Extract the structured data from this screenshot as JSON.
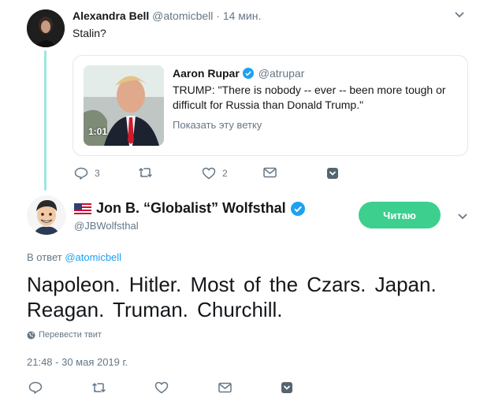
{
  "reply_tweet": {
    "author_name": "Alexandra Bell",
    "author_handle": "@atomicbell",
    "time_ago": "· 14 мин.",
    "text": "Stalin?",
    "quote": {
      "author_name": "Aaron Rupar",
      "author_handle": "@atrupar",
      "text": "TRUMP: \"There is nobody -- ever -- been more tough or difficult for Russia than Donald Trump.\"",
      "show_thread": "Показать эту ветку",
      "video_duration": "1:01"
    },
    "actions": {
      "reply_count": "3",
      "retweet_count": "",
      "like_count": "2"
    }
  },
  "main_tweet": {
    "flag_icon": "us-flag-icon",
    "author_name": "Jon B. “Globalist” Wolfsthal",
    "author_handle": "@JBWolfsthal",
    "follow_label": "Читаю",
    "reply_to_prefix": "В ответ",
    "reply_to_handle": "@atomicbell",
    "text": "Napoleon.  Hitler.  Most of the Czars.  Japan.  Reagan.  Truman.  Churchill.",
    "translate_label": "Перевести твит",
    "timestamp": "21:48 - 30 мая 2019 г."
  },
  "colors": {
    "accent": "#1da1f2",
    "follow_button": "#3ccf8e",
    "thread_line": "#9ee6dd",
    "muted": "#657786"
  }
}
